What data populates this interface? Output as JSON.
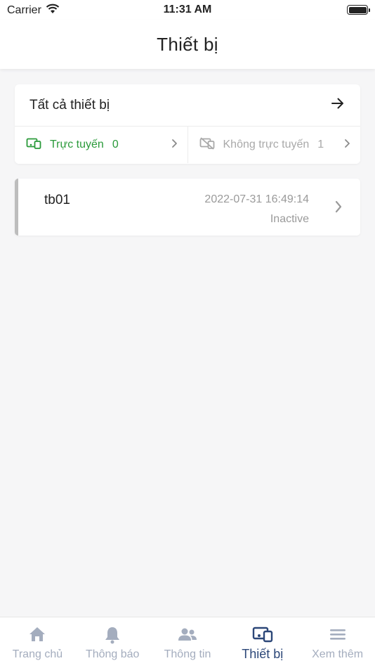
{
  "status_bar": {
    "carrier": "Carrier",
    "time": "11:31 AM"
  },
  "header": {
    "title": "Thiết bị"
  },
  "summary": {
    "all_label": "Tất cả thiết bị",
    "online_label": "Trực tuyến",
    "online_count": "0",
    "offline_label": "Không trực tuyến",
    "offline_count": "1"
  },
  "devices": [
    {
      "name": "tb01",
      "last_seen": "2022-07-31 16:49:14",
      "status": "Inactive"
    }
  ],
  "tabs": [
    {
      "label": "Trang chủ",
      "icon": "home-icon"
    },
    {
      "label": "Thông báo",
      "icon": "bell-icon"
    },
    {
      "label": "Thông tin",
      "icon": "users-icon"
    },
    {
      "label": "Thiết bị",
      "icon": "devices-icon",
      "active": true
    },
    {
      "label": "Xem thêm",
      "icon": "menu-icon"
    }
  ],
  "colors": {
    "online": "#2a9a3a",
    "offline": "#a9a9a9",
    "tab_active": "#2c4778",
    "tab_inactive": "#a4adbe"
  }
}
